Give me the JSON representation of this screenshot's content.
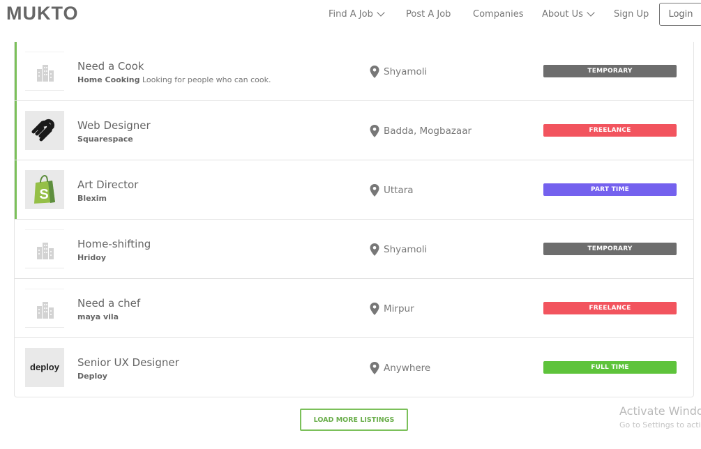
{
  "header": {
    "logo": "MUKTO",
    "nav": {
      "find_job": "Find A Job",
      "post_job": "Post A Job",
      "companies": "Companies",
      "about_us": "About Us",
      "sign_up": "Sign Up",
      "login": "Login"
    }
  },
  "listings": [
    {
      "title": "Need a Cook",
      "company": "Home Cooking",
      "description": "Looking for people who can cook.",
      "location": "Shyamoli",
      "type": "TEMPORARY",
      "type_color": "#6d6d6d",
      "logo": "building-icon",
      "featured": true
    },
    {
      "title": "Web Designer",
      "company": "Squarespace",
      "location": "Badda, Mogbazaar",
      "type": "FREELANCE",
      "type_color": "#f2545e",
      "logo": "squarespace-logo",
      "featured": true
    },
    {
      "title": "Art Director",
      "company": "Blexim",
      "location": "Uttara",
      "type": "PART TIME",
      "type_color": "#7461ee",
      "logo": "shopify-bag-logo",
      "featured": true
    },
    {
      "title": "Home-shifting",
      "company": "Hridoy",
      "location": "Shyamoli",
      "type": "TEMPORARY",
      "type_color": "#6d6d6d",
      "logo": "building-icon",
      "featured": false
    },
    {
      "title": "Need a chef",
      "company": "maya vila",
      "location": "Mirpur",
      "type": "FREELANCE",
      "type_color": "#f2545e",
      "logo": "building-icon",
      "featured": false
    },
    {
      "title": "Senior UX Designer",
      "company": "Deploy",
      "location": "Anywhere",
      "type": "FULL TIME",
      "type_color": "#5ec33b",
      "logo": "deploy-logo",
      "logo_text": "deploy",
      "featured": false
    }
  ],
  "load_more": "LOAD MORE LISTINGS",
  "watermark": {
    "line1": "Activate Windo",
    "line2": "Go to Settings to acti"
  },
  "colors": {
    "accent": "#7bc05a"
  }
}
